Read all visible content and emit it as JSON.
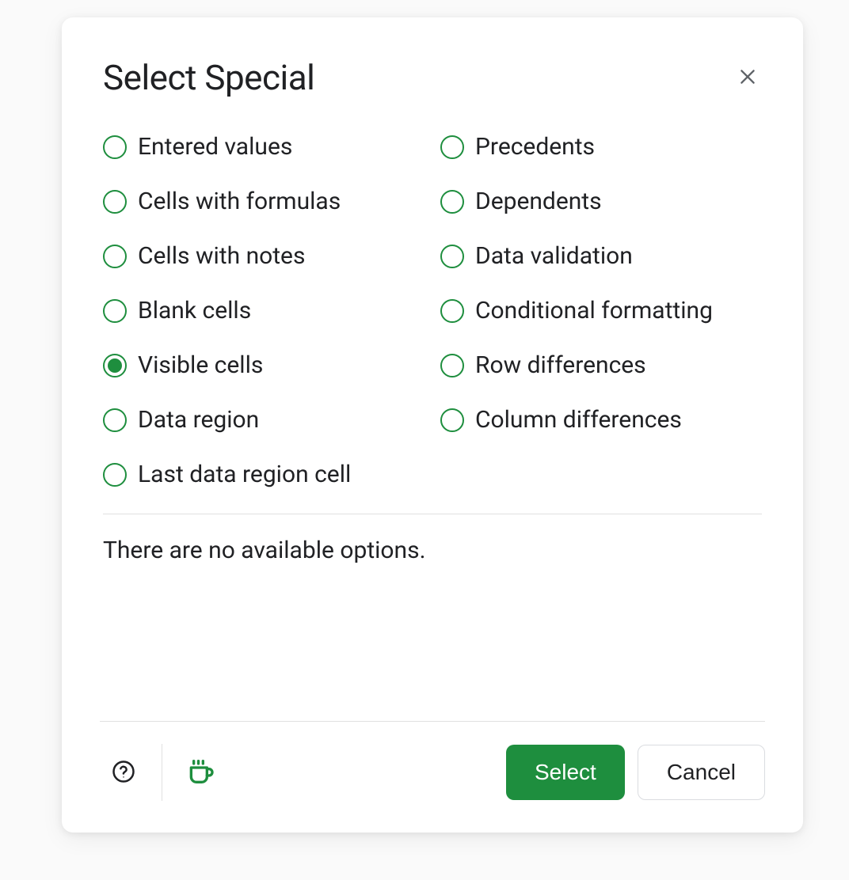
{
  "dialog": {
    "title": "Select Special",
    "options_left": [
      {
        "id": "entered-values",
        "label": "Entered values",
        "selected": false
      },
      {
        "id": "cells-with-formulas",
        "label": "Cells with formulas",
        "selected": false
      },
      {
        "id": "cells-with-notes",
        "label": "Cells with notes",
        "selected": false
      },
      {
        "id": "blank-cells",
        "label": "Blank cells",
        "selected": false
      },
      {
        "id": "visible-cells",
        "label": "Visible cells",
        "selected": true
      },
      {
        "id": "data-region",
        "label": "Data region",
        "selected": false
      },
      {
        "id": "last-data-region-cell",
        "label": "Last data region cell",
        "selected": false
      }
    ],
    "options_right": [
      {
        "id": "precedents",
        "label": "Precedents",
        "selected": false
      },
      {
        "id": "dependents",
        "label": "Dependents",
        "selected": false
      },
      {
        "id": "data-validation",
        "label": "Data validation",
        "selected": false
      },
      {
        "id": "conditional-formatting",
        "label": "Conditional formatting",
        "selected": false
      },
      {
        "id": "row-differences",
        "label": "Row differences",
        "selected": false
      },
      {
        "id": "column-differences",
        "label": "Column differences",
        "selected": false
      }
    ],
    "message": "There are no available options.",
    "buttons": {
      "select": "Select",
      "cancel": "Cancel"
    }
  }
}
